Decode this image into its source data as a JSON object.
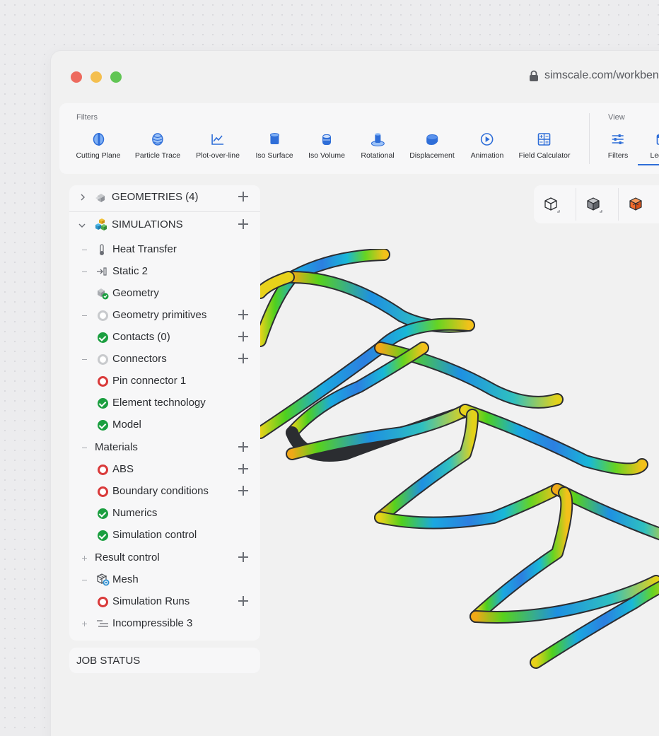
{
  "browser": {
    "url": "simscale.com/workbench"
  },
  "toolbar": {
    "filters_label": "Filters",
    "view_label": "View",
    "tools": [
      {
        "label": "Cutting Plane",
        "icon": "cutting-plane-icon"
      },
      {
        "label": "Particle Trace",
        "icon": "particle-trace-icon"
      },
      {
        "label": "Plot-over-line",
        "icon": "plot-over-line-icon"
      },
      {
        "label": "Iso Surface",
        "icon": "iso-surface-icon"
      },
      {
        "label": "Iso Volume",
        "icon": "iso-volume-icon"
      },
      {
        "label": "Rotational",
        "icon": "rotational-icon"
      },
      {
        "label": "Displacement",
        "icon": "displacement-icon"
      },
      {
        "label": "Animation",
        "icon": "animation-icon"
      },
      {
        "label": "Field Calculator",
        "icon": "field-calculator-icon"
      }
    ],
    "view_tools": [
      {
        "label": "Filters",
        "icon": "filters-sliders-icon"
      },
      {
        "label": "Legend",
        "icon": "legend-icon"
      }
    ]
  },
  "tree": {
    "geometries": "GEOMETRIES (4)",
    "simulations": "SIMULATIONS",
    "items": [
      {
        "label": "Heat Transfer",
        "icon": "thermometer-icon"
      },
      {
        "label": "Static 2",
        "icon": "static-analysis-icon"
      },
      {
        "label": "Geometry",
        "icon": "geometry-check-icon",
        "status": "ok"
      },
      {
        "label": "Geometry primitives",
        "status": "none"
      },
      {
        "label": "Contacts (0)",
        "status": "ok"
      },
      {
        "label": "Connectors",
        "status": "none"
      },
      {
        "label": "Pin connector 1",
        "status": "error"
      },
      {
        "label": "Element technology",
        "status": "ok"
      },
      {
        "label": "Model",
        "status": "ok"
      },
      {
        "label": "Materials"
      },
      {
        "label": "ABS",
        "status": "error"
      },
      {
        "label": "Boundary conditions",
        "status": "error"
      },
      {
        "label": "Numerics",
        "status": "ok"
      },
      {
        "label": "Simulation control",
        "status": "ok"
      },
      {
        "label": "Result control"
      },
      {
        "label": "Mesh",
        "icon": "mesh-icon"
      },
      {
        "label": "Simulation Runs",
        "status": "error"
      },
      {
        "label": "Incompressible 3",
        "icon": "incompressible-icon"
      }
    ]
  },
  "job_status": {
    "label": "JOB STATUS"
  },
  "colors": {
    "accent": "#2f6ed8",
    "status_ok": "#1a9e3f",
    "status_error": "#d93a3a",
    "orange_cube": "#f26b2a"
  }
}
